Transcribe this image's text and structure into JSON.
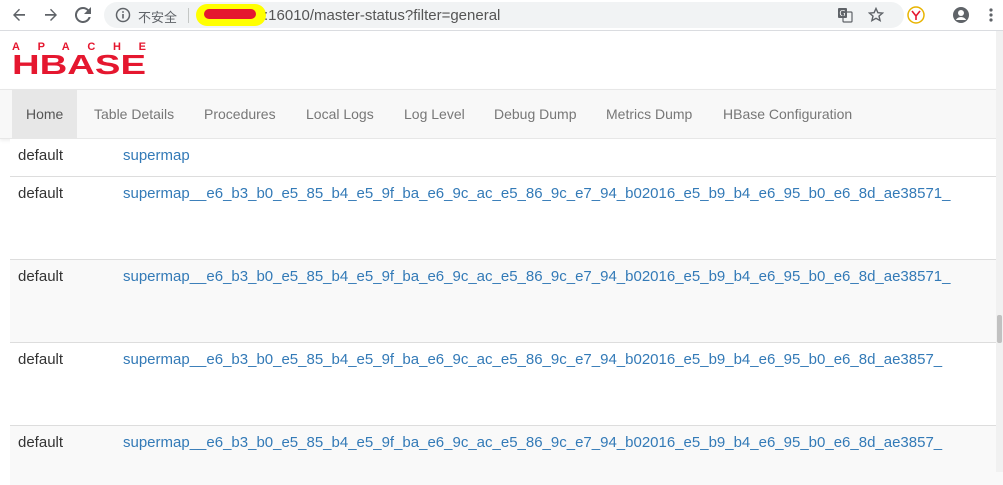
{
  "browser": {
    "security_label": "不安全",
    "url": ":16010/master-status?filter=general",
    "icons": [
      "back-icon",
      "forward-icon",
      "reload-icon",
      "info-icon",
      "translate-icon",
      "star-icon",
      "extension-icon",
      "account-icon",
      "menu-icon"
    ]
  },
  "logo": {
    "top": "APACHE",
    "bottom": "HBASE",
    "color": "#e5172f"
  },
  "nav": {
    "items": [
      {
        "label": "Home"
      },
      {
        "label": "Table Details"
      },
      {
        "label": "Procedures"
      },
      {
        "label": "Local Logs"
      },
      {
        "label": "Log Level"
      },
      {
        "label": "Debug Dump"
      },
      {
        "label": "Metrics Dump"
      },
      {
        "label": "HBase Configuration"
      }
    ]
  },
  "tables": {
    "rows": [
      {
        "namespace": "default",
        "name": "supermap"
      },
      {
        "namespace": "default",
        "name": "supermap__e6_b3_b0_e5_85_b4_e5_9f_ba_e6_9c_ac_e5_86_9c_e7_94_b02016_e5_b9_b4_e6_95_b0_e6_8d_ae38571_"
      },
      {
        "namespace": "default",
        "name": "supermap__e6_b3_b0_e5_85_b4_e5_9f_ba_e6_9c_ac_e5_86_9c_e7_94_b02016_e5_b9_b4_e6_95_b0_e6_8d_ae38571_"
      },
      {
        "namespace": "default",
        "name": "supermap__e6_b3_b0_e5_85_b4_e5_9f_ba_e6_9c_ac_e5_86_9c_e7_94_b02016_e5_b9_b4_e6_95_b0_e6_8d_ae3857_"
      },
      {
        "namespace": "default",
        "name": "supermap__e6_b3_b0_e5_85_b4_e5_9f_ba_e6_9c_ac_e5_86_9c_e7_94_b02016_e5_b9_b4_e6_95_b0_e6_8d_ae3857_"
      }
    ]
  },
  "colors": {
    "link": "#337ab7",
    "text": "#333333",
    "nav_bg": "#f8f8f8"
  }
}
